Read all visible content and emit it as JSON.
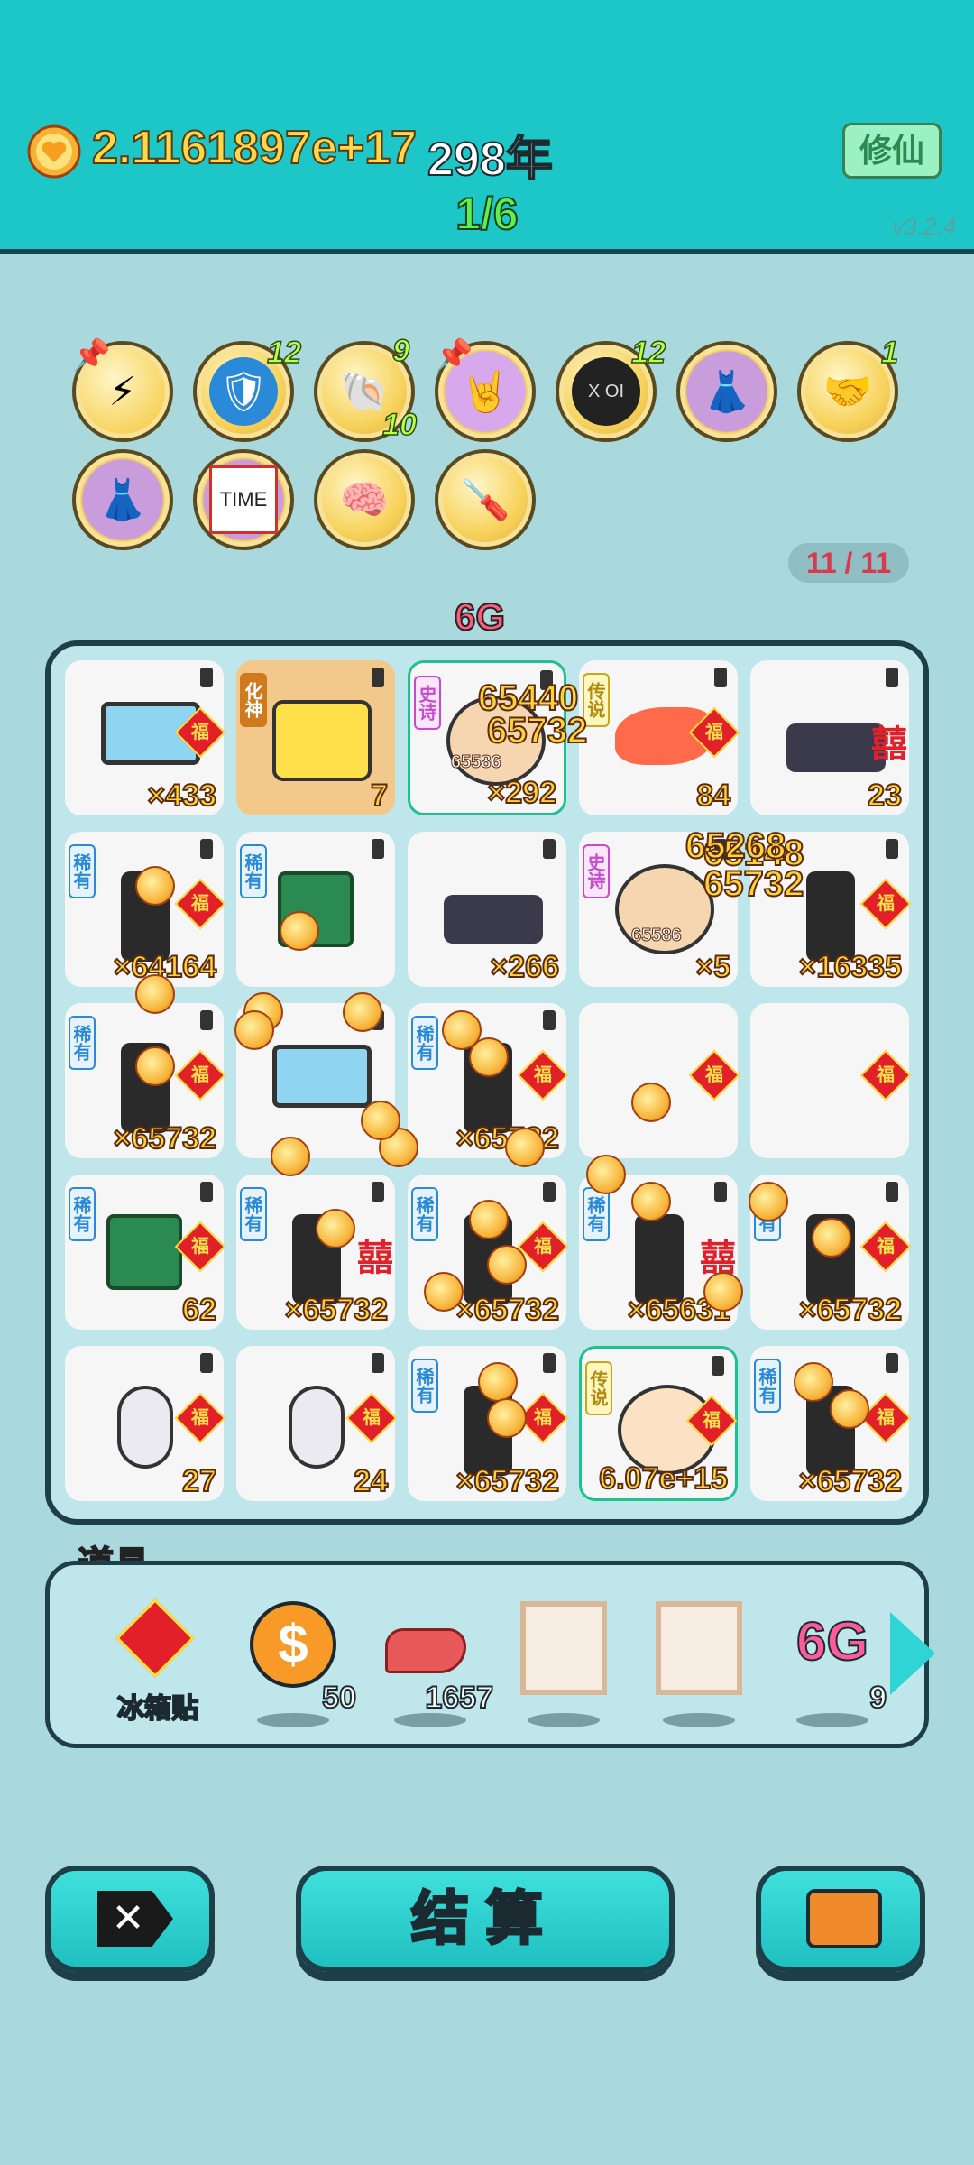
{
  "hud": {
    "coin_icon": "heart-coin-icon",
    "money": "2.1161897e+17",
    "years": "298年",
    "progress": "1/6",
    "xiuxian_button": "修仙",
    "version": "v3.2.4"
  },
  "buffs": [
    {
      "icon": "lightning-icon",
      "level": "",
      "pinned": true
    },
    {
      "icon": "shield-wrench-icon",
      "level": "12",
      "pinned": false
    },
    {
      "icon": "shell-icon",
      "level": "9",
      "level2": "10",
      "pinned": false
    },
    {
      "icon": "rock-hand-icon",
      "level": "",
      "pinned": true
    },
    {
      "icon": "chip-icon",
      "label": "X OI",
      "level": "12",
      "pinned": false
    },
    {
      "icon": "skirt-icon",
      "level": "",
      "pinned": false
    },
    {
      "icon": "handshake-icon",
      "level": "1",
      "pinned": false
    },
    {
      "icon": "skirt-icon",
      "level": "",
      "pinned": false
    },
    {
      "icon": "time-magazine-icon",
      "label": "TIME",
      "level": "",
      "pinned": false
    },
    {
      "icon": "math-head-icon",
      "level": "",
      "pinned": false
    },
    {
      "icon": "screwdriver-icon",
      "level": "",
      "pinned": false
    }
  ],
  "slot_counter": "11 / 11",
  "board": {
    "top_badge": "6G",
    "cells": [
      {
        "item": "monitor-icon",
        "tag": "",
        "fu": true,
        "count": "×433"
      },
      {
        "item": "6g-god-icon",
        "tag": "化神",
        "fu": false,
        "count": "7",
        "tan": true
      },
      {
        "item": "old-man-icon",
        "tag": "史诗",
        "fu": false,
        "count": "×292",
        "selected": true
      },
      {
        "item": "koi-fish-icon",
        "tag": "传说",
        "fu": true,
        "count": "84"
      },
      {
        "item": "keyboard-icon",
        "tag": "",
        "xi": "囍",
        "count": "23"
      },
      {
        "item": "pc-tower-icon",
        "tag": "稀有",
        "fu": true,
        "count": "×64164"
      },
      {
        "item": "cpu-icon",
        "tag": "稀有",
        "fu": false,
        "count": ""
      },
      {
        "item": "keyboard-icon",
        "tag": "",
        "fu": false,
        "count": "×266"
      },
      {
        "item": "old-man-icon",
        "tag": "史诗",
        "fu": false,
        "count": "×5"
      },
      {
        "item": "pc-tower-icon",
        "tag": "",
        "fu": true,
        "count": "×16335"
      },
      {
        "item": "pc-tower-icon",
        "tag": "稀有",
        "fu": true,
        "count": "×65732"
      },
      {
        "item": "monitor-icon",
        "tag": "",
        "fu": false,
        "count": ""
      },
      {
        "item": "pc-tower-icon",
        "tag": "稀有",
        "fu": true,
        "count": "×65732"
      },
      {
        "item": "empty",
        "tag": "",
        "fu": true,
        "count": ""
      },
      {
        "item": "empty",
        "tag": "",
        "fu": true,
        "count": ""
      },
      {
        "item": "cpu-icon",
        "tag": "稀有",
        "fu": true,
        "count": "62"
      },
      {
        "item": "pc-tower-icon",
        "tag": "稀有",
        "xi": "囍",
        "count": "×65732"
      },
      {
        "item": "pc-tower-icon",
        "tag": "稀有",
        "fu": true,
        "count": "×65732"
      },
      {
        "item": "pc-tower-icon",
        "tag": "稀有",
        "xi": "囍",
        "count": "×65631"
      },
      {
        "item": "pc-tower-icon",
        "tag": "稀有",
        "fu": true,
        "count": "×65732"
      },
      {
        "item": "mouse-icon",
        "tag": "",
        "fu": true,
        "count": "27"
      },
      {
        "item": "mouse-icon",
        "tag": "",
        "fu": true,
        "count": "24"
      },
      {
        "item": "pc-tower-icon",
        "tag": "稀有",
        "fu": true,
        "count": "×65732"
      },
      {
        "item": "king-icon",
        "tag": "传说",
        "fu": true,
        "count": "6.07e+15",
        "selected": true
      },
      {
        "item": "pc-tower-icon",
        "tag": "稀有",
        "fu": true,
        "count": "×65732"
      }
    ],
    "floating": [
      "65440",
      "65732",
      "65586",
      "65148",
      "65732",
      "65586",
      "65268"
    ]
  },
  "items": {
    "title": "道具",
    "list": [
      {
        "icon": "fu-sticker-icon",
        "name": "冰箱贴",
        "qty": ""
      },
      {
        "icon": "dollar-coin-icon",
        "name": "",
        "qty": "50"
      },
      {
        "icon": "liver-icon",
        "name": "",
        "qty": "1657"
      },
      {
        "icon": "frame-icon",
        "name": "",
        "qty": ""
      },
      {
        "icon": "frame-icon",
        "name": "",
        "qty": ""
      },
      {
        "icon": "6g-icon",
        "name": "6G",
        "qty": "9"
      }
    ]
  },
  "actions": {
    "cancel_icon": "close-x-icon",
    "settle_label": "结算",
    "bag_icon": "briefcase-icon"
  },
  "colors": {
    "hud_bg": "#1ec7c7",
    "page_bg": "#a9d8dd",
    "coin_gold": "#ffd23a",
    "fu_red": "#e2202a"
  }
}
